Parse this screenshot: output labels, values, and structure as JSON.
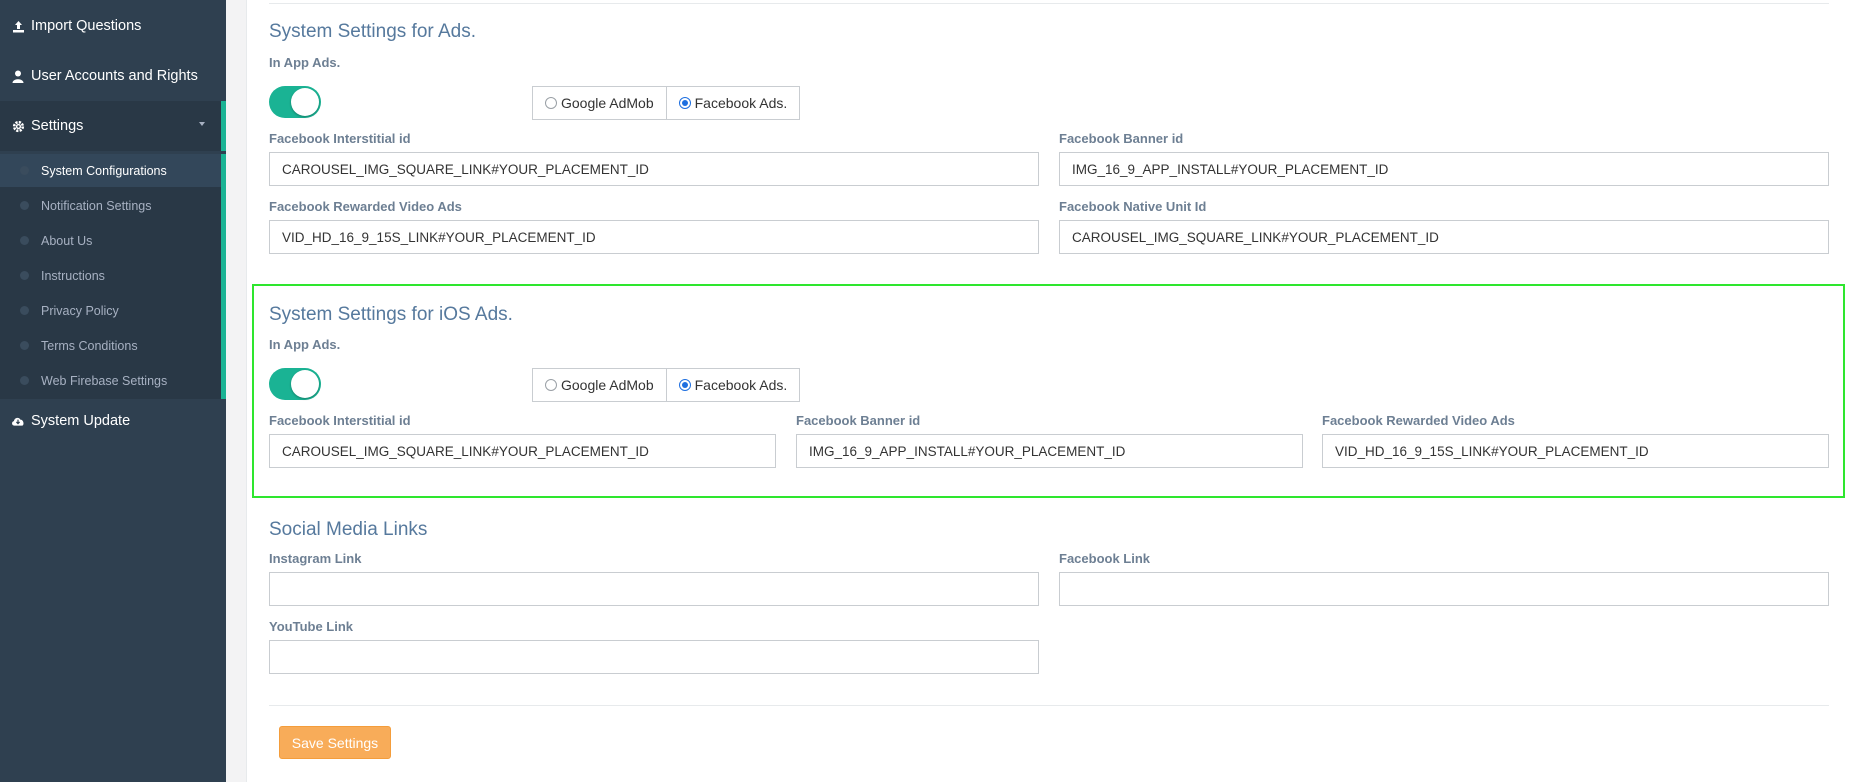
{
  "sidebar": {
    "import_questions": "Import Questions",
    "user_accounts": "User Accounts and Rights",
    "settings": "Settings",
    "submenu": [
      "System Configurations",
      "Notification Settings",
      "About Us",
      "Instructions",
      "Privacy Policy",
      "Terms Conditions",
      "Web Firebase Settings"
    ],
    "system_update": "System Update"
  },
  "ads": {
    "title": "System Settings for Ads.",
    "in_app_label": "In App Ads.",
    "in_app_enabled": true,
    "option_admob": "Google AdMob",
    "option_facebook": "Facebook Ads.",
    "selected": "Facebook Ads.",
    "interstitial_label": "Facebook Interstitial id",
    "interstitial_value": "CAROUSEL_IMG_SQUARE_LINK#YOUR_PLACEMENT_ID",
    "banner_label": "Facebook Banner id",
    "banner_value": "IMG_16_9_APP_INSTALL#YOUR_PLACEMENT_ID",
    "rewarded_label": "Facebook Rewarded Video Ads",
    "rewarded_value": "VID_HD_16_9_15S_LINK#YOUR_PLACEMENT_ID",
    "native_label": "Facebook Native Unit Id",
    "native_value": "CAROUSEL_IMG_SQUARE_LINK#YOUR_PLACEMENT_ID"
  },
  "ios_ads": {
    "title": "System Settings for iOS Ads.",
    "in_app_label": "In App Ads.",
    "in_app_enabled": true,
    "option_admob": "Google AdMob",
    "option_facebook": "Facebook Ads.",
    "selected": "Facebook Ads.",
    "interstitial_label": "Facebook Interstitial id",
    "interstitial_value": "CAROUSEL_IMG_SQUARE_LINK#YOUR_PLACEMENT_ID",
    "banner_label": "Facebook Banner id",
    "banner_value": "IMG_16_9_APP_INSTALL#YOUR_PLACEMENT_ID",
    "rewarded_label": "Facebook Rewarded Video Ads",
    "rewarded_value": "VID_HD_16_9_15S_LINK#YOUR_PLACEMENT_ID"
  },
  "social": {
    "title": "Social Media Links",
    "instagram_label": "Instagram Link",
    "instagram_value": "",
    "facebook_label": "Facebook Link",
    "facebook_value": "",
    "youtube_label": "YouTube Link",
    "youtube_value": ""
  },
  "save_label": "Save Settings",
  "colors": {
    "sidebar_bg": "#2f4050",
    "accent": "#1ab394",
    "save_button": "#f8ac59",
    "highlight_border": "#2ee62e"
  }
}
